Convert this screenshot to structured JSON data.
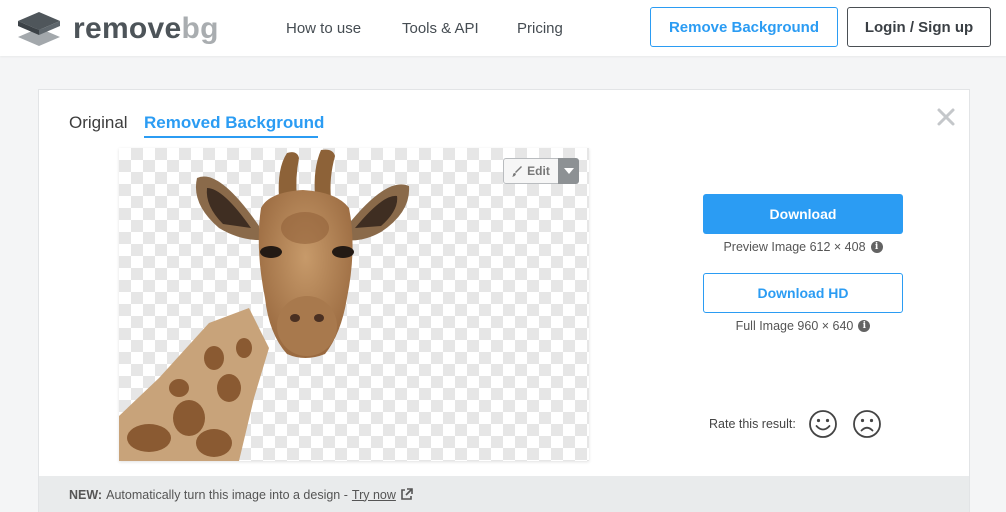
{
  "header": {
    "logo_remove": "remove",
    "logo_bg": "bg",
    "nav": [
      "How to use",
      "Tools & API",
      "Pricing"
    ],
    "remove_background_button": "Remove Background",
    "login_button": "Login / Sign up"
  },
  "card": {
    "tabs": {
      "original": "Original",
      "removed": "Removed Background"
    },
    "edit_label": "Edit",
    "download_label": "Download",
    "preview_info": "Preview Image 612 × 408",
    "download_hd_label": "Download HD",
    "full_info": "Full Image 960 × 640",
    "rate_label": "Rate this result:",
    "footer": {
      "new_label": "NEW:",
      "text": "Automatically turn this image into a design -",
      "link": "Try now"
    }
  },
  "icons": {
    "logo": "layers-icon",
    "close": "close-icon",
    "edit": "brush-icon",
    "caret": "caret-down-icon",
    "info": "info-icon",
    "rate_good": "smiley-happy-icon",
    "rate_bad": "smiley-sad-icon",
    "external": "external-link-icon"
  },
  "colors": {
    "accent": "#2b9cf3",
    "dark": "#4d5459",
    "light_logo": "#a9adb0"
  }
}
